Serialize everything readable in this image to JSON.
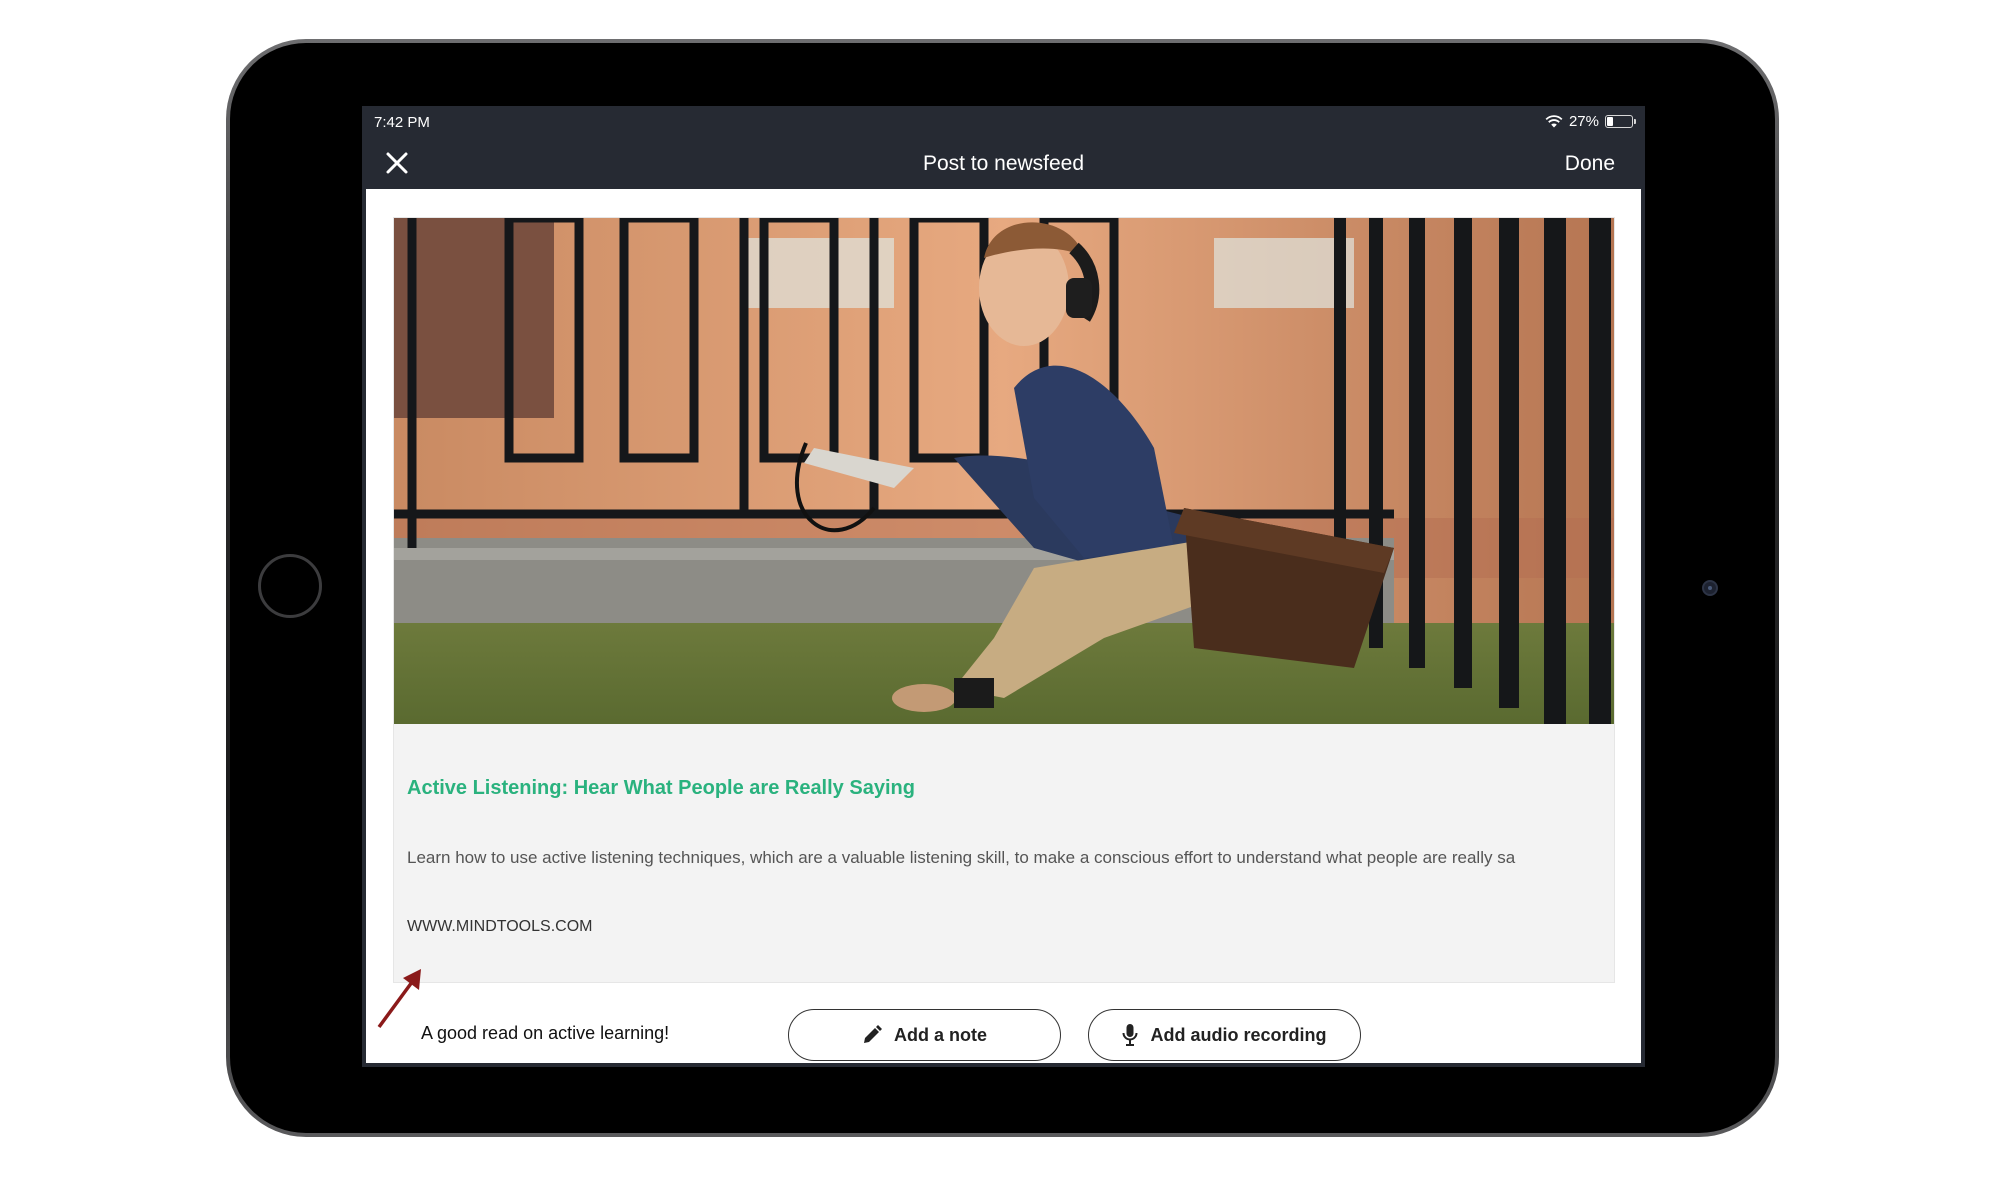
{
  "status_bar": {
    "time": "7:42 PM",
    "battery": "27%",
    "battery_level": 0.27,
    "wifi_icon": "wifi-icon"
  },
  "nav": {
    "title": "Post to newsfeed",
    "done_label": "Done",
    "close_icon": "close-icon"
  },
  "card": {
    "image": "photo of young man with headphones reading a tablet",
    "title": "Active Listening: Hear What People are Really Saying",
    "description": "Learn how to use active listening techniques, which are a valuable listening skill, to make a conscious effort to understand what people are really sa",
    "domain": "WWW.MINDTOOLS.COM"
  },
  "composer": {
    "note_text": "A good read on active learning!",
    "add_note_label": "Add a note",
    "add_audio_label": "Add audio recording"
  },
  "colors": {
    "nav_bg": "#262a33",
    "title_green": "#2ab27e",
    "annotation_arrow": "#8b1a1a"
  }
}
